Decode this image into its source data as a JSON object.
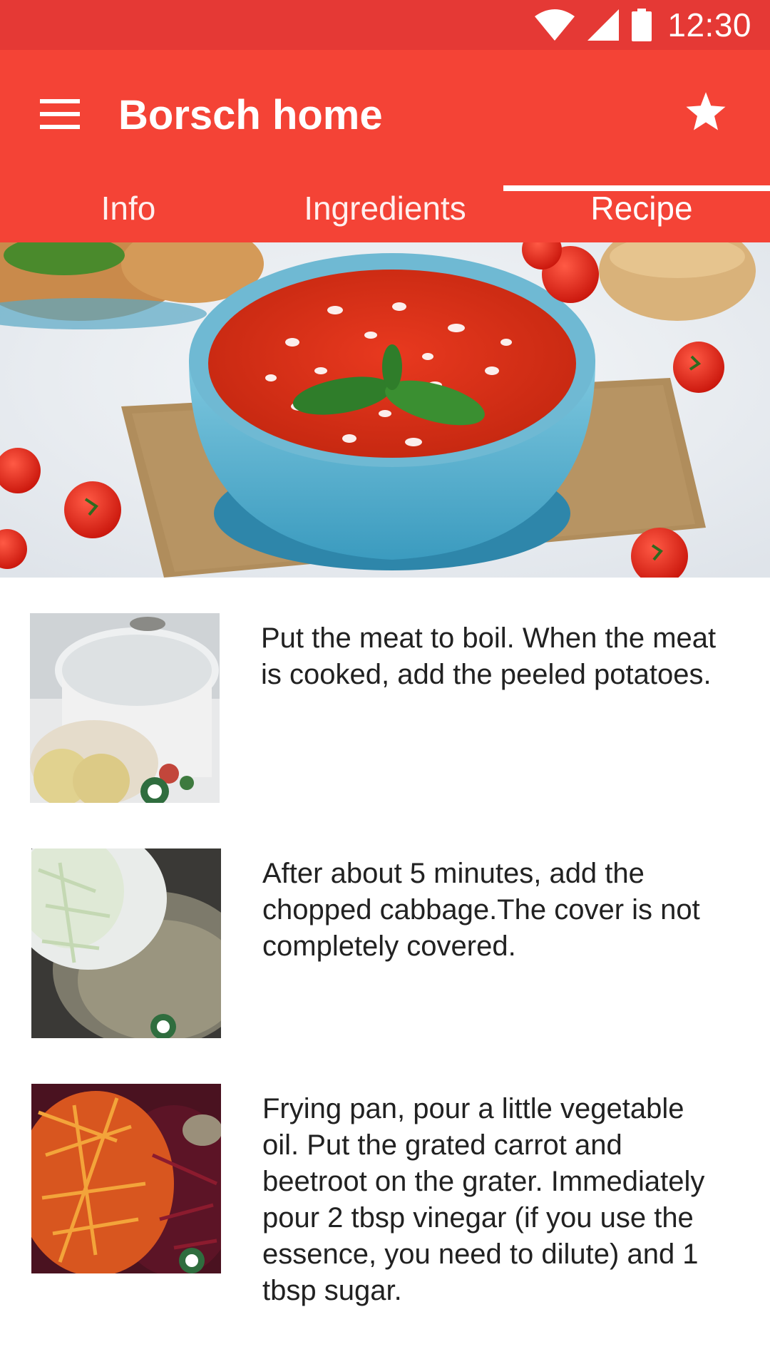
{
  "status_bar": {
    "time": "12:30",
    "icons": [
      "wifi-icon",
      "cell-signal-icon",
      "battery-icon"
    ]
  },
  "app_bar": {
    "title": "Borsch home",
    "menu_icon": "hamburger-menu-icon",
    "action_icon": "star-icon",
    "tabs": [
      {
        "label": "Info",
        "selected": false
      },
      {
        "label": "Ingredients",
        "selected": false
      },
      {
        "label": "Recipe",
        "selected": true
      }
    ]
  },
  "colors": {
    "status_bar": "#e53935",
    "app_bar": "#f44336",
    "text": "#212121"
  },
  "steps": [
    {
      "text": "Put the meat to boil. When the meat is cooked, add the peeled potatoes."
    },
    {
      "text": "After about 5 minutes, add the chopped cabbage.The cover is not completely covered."
    },
    {
      "text": "Frying pan, pour a little vegetable oil. Put the grated carrot and beetroot on the grater. Immediately pour 2 tbsp vinegar (if you use the essence, you need to dilute) and 1 tbsp sugar."
    }
  ]
}
